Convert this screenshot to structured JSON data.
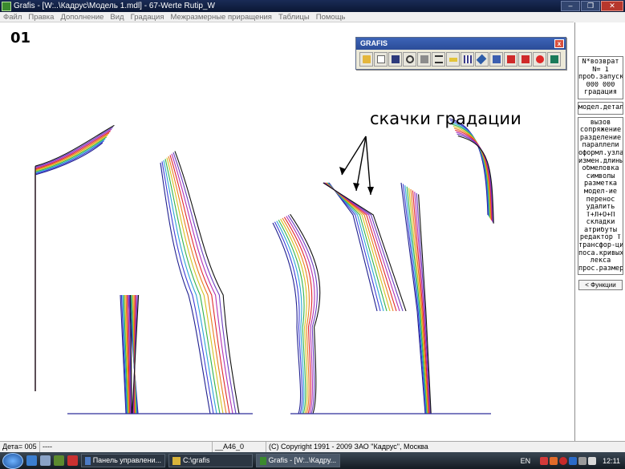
{
  "window": {
    "title": "Grafis - [W:..\\Кадрус\\Модель 1.mdl] - 67-Werte Rutip_W",
    "minimize": "–",
    "restore": "❐",
    "close": "✕"
  },
  "menu": [
    "Файл",
    "Правка",
    "Дополнение",
    "Вид",
    "Градация",
    "Межразмерные приращения",
    "Таблицы",
    "Помощь"
  ],
  "canvas": {
    "sheet_label": "01",
    "annotation": "скачки градации"
  },
  "floating_toolbar": {
    "title": "GRAFIS",
    "close": "x",
    "icons": [
      "open-folder-icon",
      "page-icon",
      "save-disk-icon",
      "zoom-icon",
      "print-icon",
      "layers-icon",
      "ruler-icon",
      "grid-icon",
      "scissors-icon",
      "edit-icon",
      "export-down-icon",
      "import-down-icon",
      "stop-icon",
      "screen-icon"
    ]
  },
  "right_panel": {
    "groups": [
      [
        "N*возврат",
        "N=  1",
        "проб.запуск",
        "000 000",
        "градация"
      ],
      [
        "модел.деталь"
      ],
      [
        "вызов",
        "сопряжение",
        "разделение",
        "параллели",
        "оформл.узла",
        "измен.длины",
        "обмеловка",
        "символы",
        "разметка",
        " ",
        "модел-ие",
        "перенос",
        "удалить",
        "Т+Л+О+П",
        "складки",
        " ",
        "атрибуты",
        "редактор Т",
        "трансфор-ция",
        "поса.кривых",
        " ",
        "лекса",
        "прос.размеров"
      ]
    ],
    "functions_button": "< Функции"
  },
  "status": {
    "detail": "Дета= 005",
    "blank": "----",
    "size": "__A46_0",
    "copyright": "(C) Copyright 1991 - 2009 ЗАО \"Кадрус\", Москва"
  },
  "taskbar": {
    "buttons": [
      "Панель управлени...",
      "C:\\grafis",
      "Grafis - [W:..\\Кадру..."
    ],
    "language": "EN",
    "time": "12:11"
  },
  "colors": {
    "titlebar": "#0f1f45",
    "sizes": [
      "#1f1f8f",
      "#3d3dd6",
      "#2ba3d6",
      "#32b24a",
      "#d4c21f",
      "#ea7d1d",
      "#e0292d",
      "#b331b3",
      "#6a3cbf",
      "#111111"
    ]
  }
}
